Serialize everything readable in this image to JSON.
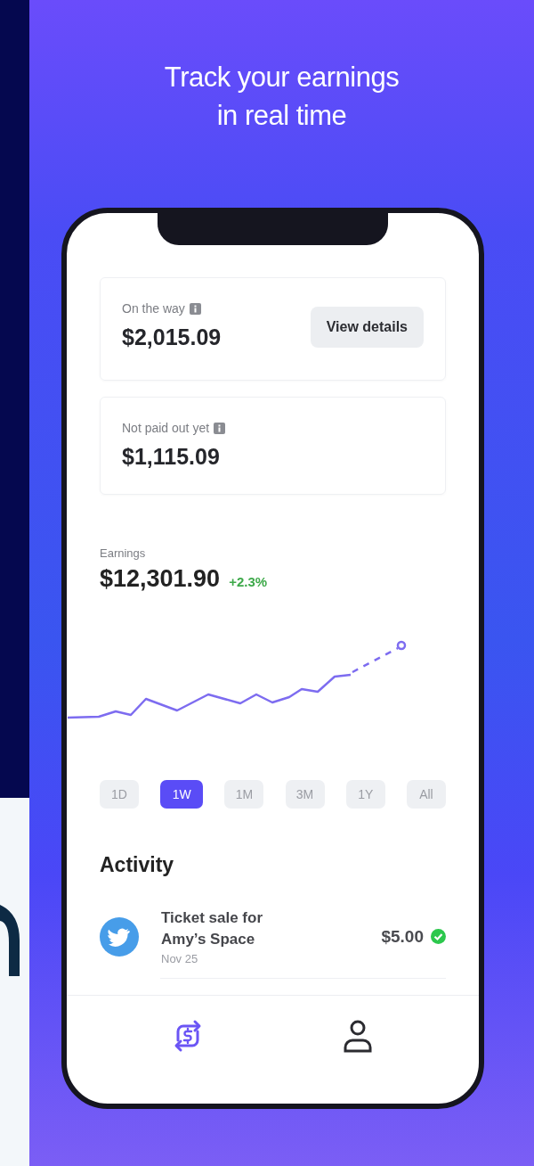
{
  "headline": "Track your earnings\nin real time",
  "balances": [
    {
      "label": "On the way",
      "amount": "$2,015.09",
      "action": "View details"
    },
    {
      "label": "Not paid out yet",
      "amount": "$1,115.09"
    }
  ],
  "earnings": {
    "label": "Earnings",
    "amount": "$12,301.90",
    "change": "+2.3%"
  },
  "periods": [
    {
      "label": "1D",
      "selected": false
    },
    {
      "label": "1W",
      "selected": true
    },
    {
      "label": "1M",
      "selected": false
    },
    {
      "label": "3M",
      "selected": false
    },
    {
      "label": "1Y",
      "selected": false
    },
    {
      "label": "All",
      "selected": false
    }
  ],
  "activity": {
    "title": "Activity",
    "items": [
      {
        "title": "Ticket sale for Amy’s Space",
        "date": "Nov 25",
        "amount": "$5.00",
        "confirmed": true
      }
    ]
  },
  "bottom_nav": [
    {
      "kind": "earnings",
      "selected": true
    },
    {
      "kind": "profile",
      "selected": false
    }
  ]
}
